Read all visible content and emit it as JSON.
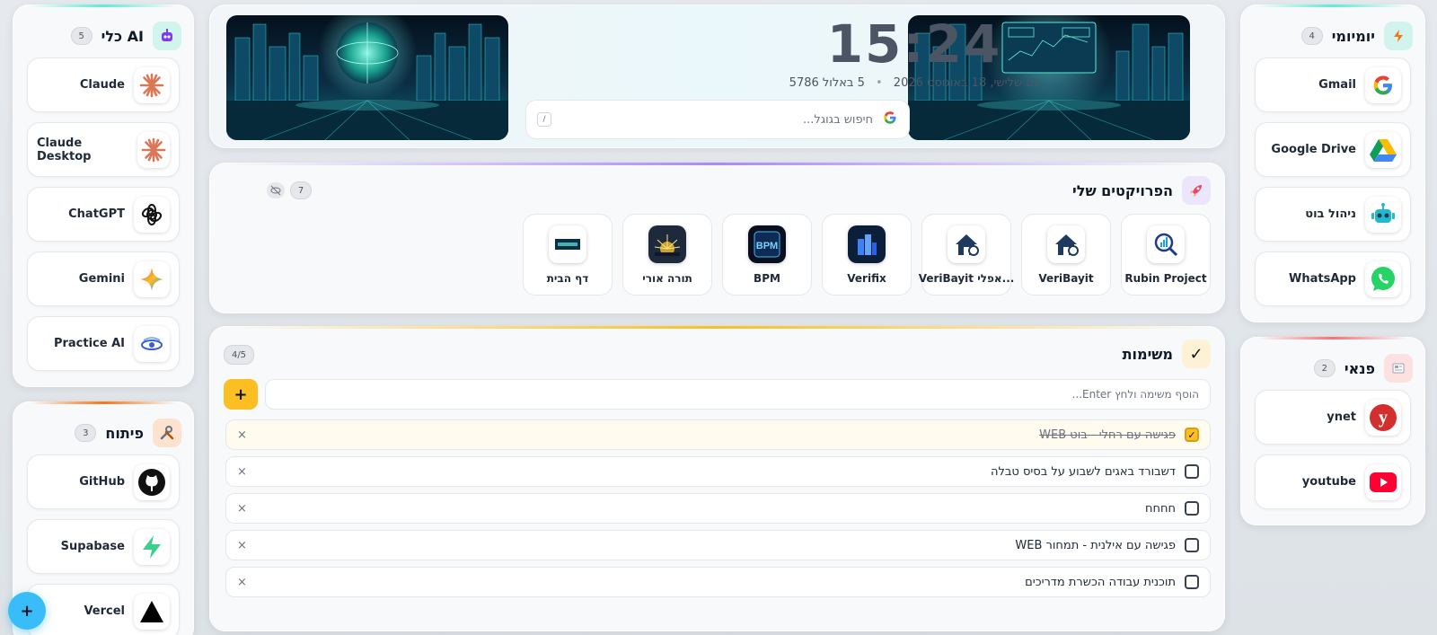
{
  "left_top": {
    "title": "כלי AI",
    "count": "5",
    "items": [
      {
        "label": "Claude",
        "icon": "claude-icon"
      },
      {
        "label": "Claude Desktop",
        "icon": "claude-icon"
      },
      {
        "label": "ChatGPT",
        "icon": "chatgpt-icon"
      },
      {
        "label": "Gemini",
        "icon": "gemini-icon"
      },
      {
        "label": "Practice AI",
        "icon": "practice-ai-icon"
      }
    ]
  },
  "left_bottom": {
    "title": "פיתוח",
    "count": "3",
    "items": [
      {
        "label": "GitHub",
        "icon": "github-icon"
      },
      {
        "label": "Supabase",
        "icon": "supabase-icon"
      },
      {
        "label": "Vercel",
        "icon": "vercel-icon"
      }
    ]
  },
  "right_top": {
    "title": "יומיומי",
    "count": "4",
    "items": [
      {
        "label": "Gmail",
        "icon": "google-icon"
      },
      {
        "label": "Google Drive",
        "icon": "google-drive-icon"
      },
      {
        "label": "ניהול בוט",
        "icon": "robot-icon"
      },
      {
        "label": "WhatsApp",
        "icon": "whatsapp-icon"
      }
    ]
  },
  "right_bottom": {
    "title": "פנאי",
    "count": "2",
    "items": [
      {
        "label": "ynet",
        "icon": "ynet-icon"
      },
      {
        "label": "youtube",
        "icon": "youtube-icon"
      }
    ]
  },
  "hero": {
    "time": "15:24",
    "date_gregorian": "יום שלישי, 18 באוגוסט 2026",
    "date_hebrew": "5 באלול 5786",
    "separator": "•",
    "search_placeholder": "חיפוש בגוגל...",
    "search_shortcut": "/"
  },
  "projects": {
    "title": "הפרויקטים שלי",
    "count": "7",
    "items": [
      {
        "label": "Rubin Project"
      },
      {
        "label": "VeriBayit"
      },
      {
        "label": "VeriBayit אפלי..."
      },
      {
        "label": "Verifix"
      },
      {
        "label": "BPM"
      },
      {
        "label": "תורה אורי"
      },
      {
        "label": "דף הבית"
      }
    ]
  },
  "tasks": {
    "title": "משימות",
    "count": "4/5",
    "input_placeholder": "הוסף משימה ולחץ Enter...",
    "add_label": "+",
    "items": [
      {
        "text": "פגישה עם רחלי - בוט WEB",
        "done": true
      },
      {
        "text": "דשבורד באגים לשבוע על בסיס טבלה",
        "done": false
      },
      {
        "text": "חחחח",
        "done": false
      },
      {
        "text": "פגישה עם אילנית - תמחור WEB",
        "done": false
      },
      {
        "text": "תוכנית עבודה הכשרת מדריכים",
        "done": false
      }
    ],
    "delete_label": "×"
  },
  "fab_label": "+",
  "colors": {
    "accent_yellow": "#fbbf24",
    "fab_cyan": "#38bdf8"
  }
}
